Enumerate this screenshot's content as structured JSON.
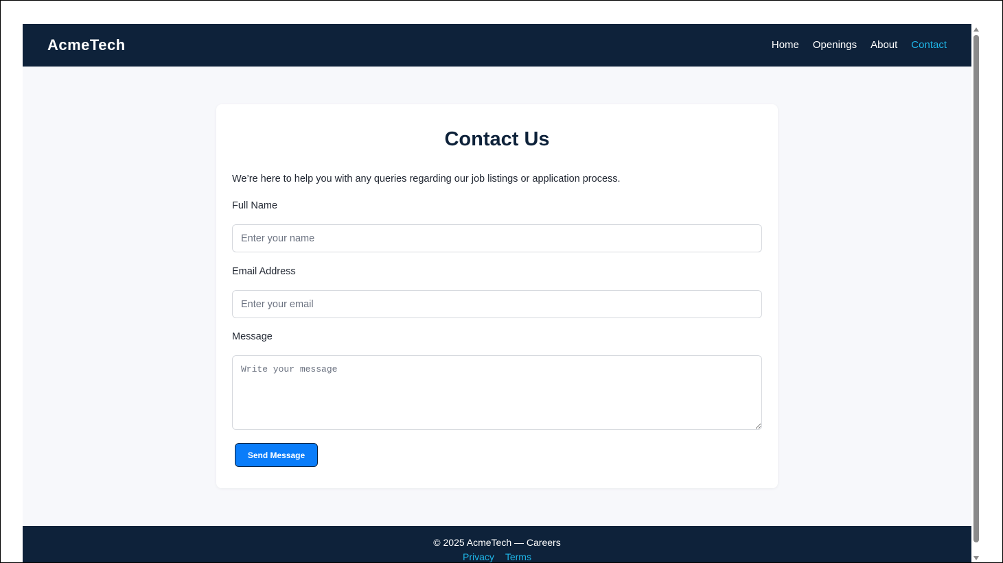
{
  "navbar": {
    "brand": "AcmeTech",
    "links": [
      {
        "label": "Home"
      },
      {
        "label": "Openings"
      },
      {
        "label": "About"
      },
      {
        "label": "Contact",
        "active": true
      }
    ]
  },
  "contact": {
    "title": "Contact Us",
    "intro": "We’re here to help you with any queries regarding our job listings or application process.",
    "name_label": "Full Name",
    "name_placeholder": "Enter your name",
    "email_label": "Email Address",
    "email_placeholder": "Enter your email",
    "message_label": "Message",
    "message_placeholder": "Write your message",
    "submit_label": "Send Message"
  },
  "footer": {
    "copyright": "© 2025 AcmeTech — Careers",
    "links": [
      "Privacy",
      "Terms"
    ]
  },
  "colors": {
    "navy": "#0e223a",
    "accent": "#1fb6e8",
    "button": "#0a7dfa",
    "page_bg": "#f7f8fb"
  }
}
